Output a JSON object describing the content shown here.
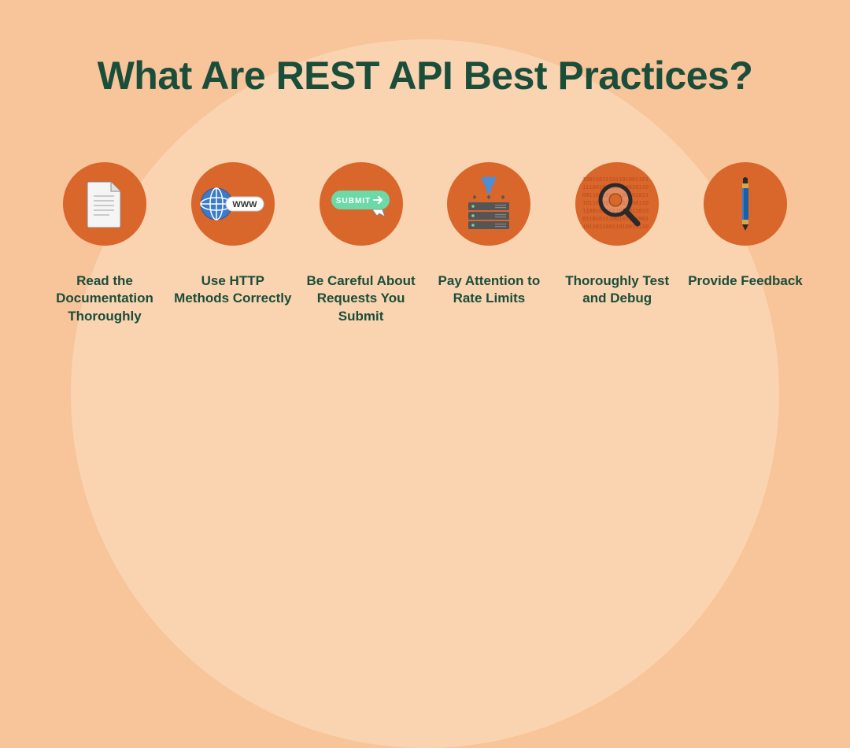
{
  "title": "What Are REST API Best Practices?",
  "items": [
    {
      "label": "Read the Documentation Thoroughly",
      "icon": "document-icon"
    },
    {
      "label": "Use HTTP Methods Correctly",
      "icon": "globe-www-icon"
    },
    {
      "label": "Be Careful About Requests You Submit",
      "icon": "submit-button-icon"
    },
    {
      "label": "Pay Attention to Rate Limits",
      "icon": "funnel-server-icon"
    },
    {
      "label": "Thoroughly Test and Debug",
      "icon": "magnifier-binary-icon"
    },
    {
      "label": "Provide Feedback",
      "icon": "pen-icon"
    }
  ],
  "colors": {
    "bg": "#f8c49a",
    "bgCircle": "#fad4b0",
    "iconCircle": "#d9662b",
    "text": "#1a4d3a"
  }
}
